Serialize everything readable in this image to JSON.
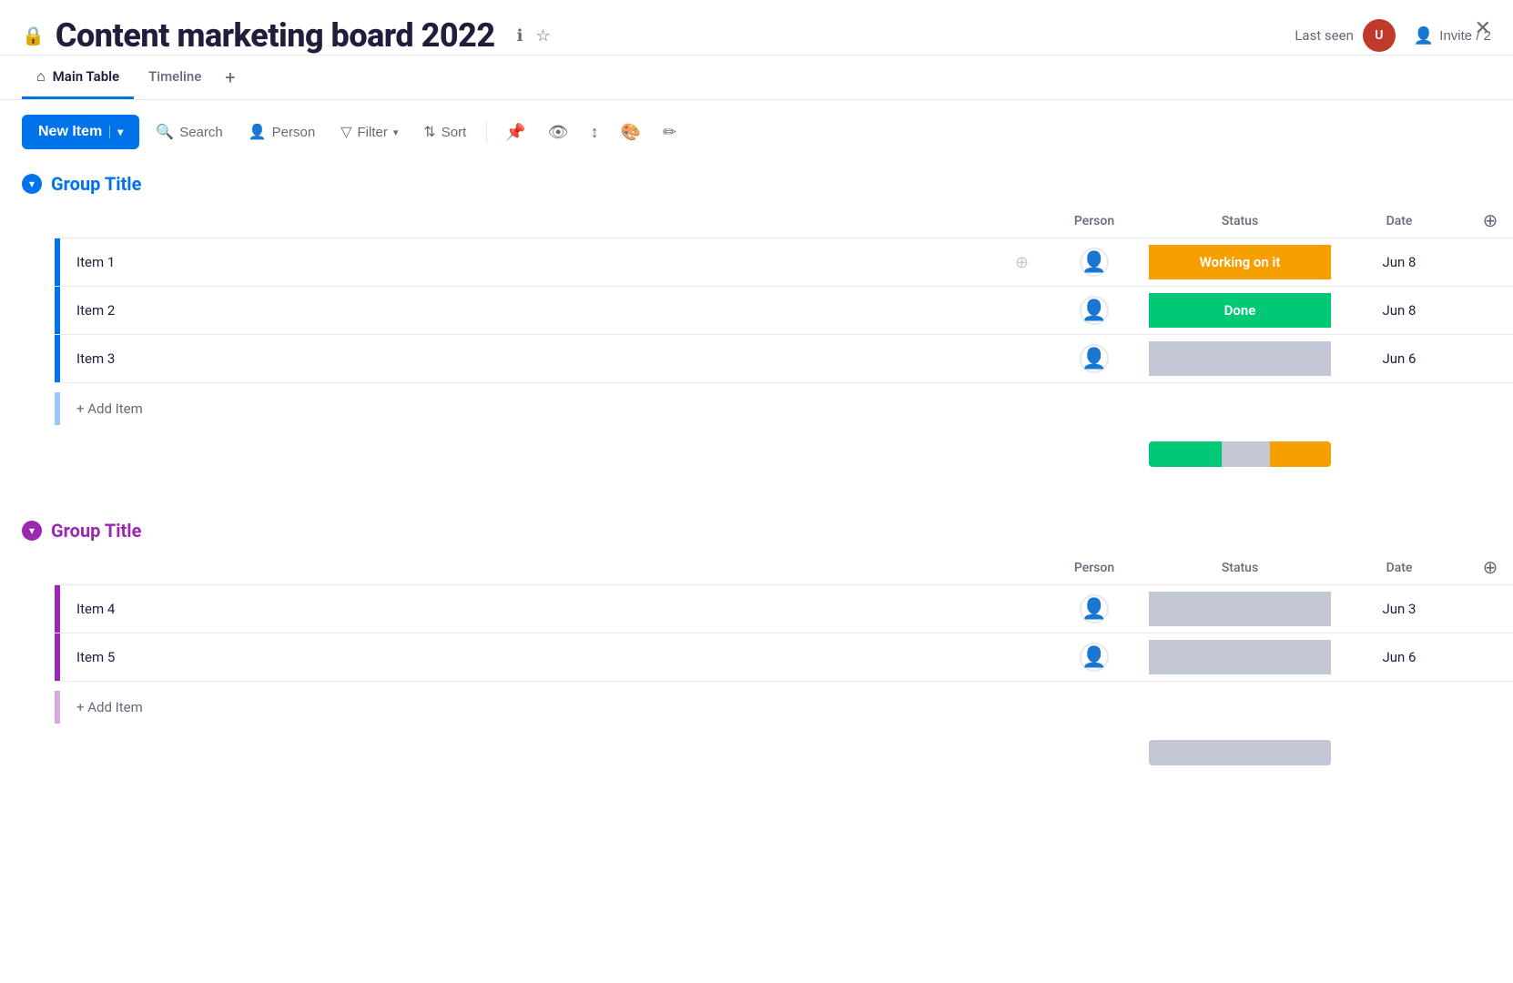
{
  "header": {
    "lock_icon": "🔒",
    "title": "Content marketing board 2022",
    "info_icon": "ℹ",
    "star_icon": "☆",
    "last_seen_label": "Last seen",
    "invite_label": "Invite / 2",
    "close_icon": "✕"
  },
  "tabs": [
    {
      "id": "main-table",
      "label": "Main Table",
      "icon": "⌂",
      "active": true
    },
    {
      "id": "timeline",
      "label": "Timeline",
      "icon": "",
      "active": false
    }
  ],
  "tab_add_label": "+",
  "toolbar": {
    "new_item_label": "New Item",
    "new_item_caret": "▾",
    "search_label": "Search",
    "person_label": "Person",
    "filter_label": "Filter",
    "filter_caret": "▾",
    "sort_label": "Sort",
    "pin_icon": "📌",
    "hide_icon": "👁",
    "row_height_icon": "↕",
    "color_icon": "🎨",
    "edit_icon": "✏"
  },
  "groups": [
    {
      "id": "group-1",
      "title": "Group Title",
      "color": "blue",
      "columns": {
        "person": "Person",
        "status": "Status",
        "date": "Date"
      },
      "rows": [
        {
          "id": "item-1",
          "name": "Item 1",
          "person": "",
          "status": "Working on it",
          "status_color": "orange",
          "date": "Jun 8"
        },
        {
          "id": "item-2",
          "name": "Item 2",
          "person": "",
          "status": "Done",
          "status_color": "green",
          "date": "Jun 8"
        },
        {
          "id": "item-3",
          "name": "Item 3",
          "person": "",
          "status": "",
          "status_color": "gray",
          "date": "Jun 6"
        }
      ],
      "add_item_label": "+ Add Item",
      "summary": {
        "green": 1.2,
        "gray": 0.8,
        "orange": 1.0
      }
    },
    {
      "id": "group-2",
      "title": "Group Title",
      "color": "purple",
      "columns": {
        "person": "Person",
        "status": "Status",
        "date": "Date"
      },
      "rows": [
        {
          "id": "item-4",
          "name": "Item 4",
          "person": "",
          "status": "",
          "status_color": "gray",
          "date": "Jun 3"
        },
        {
          "id": "item-5",
          "name": "Item 5",
          "person": "",
          "status": "",
          "status_color": "gray",
          "date": "Jun 6"
        }
      ],
      "add_item_label": "+ Add Item",
      "summary": {
        "gray_only": true
      }
    }
  ]
}
